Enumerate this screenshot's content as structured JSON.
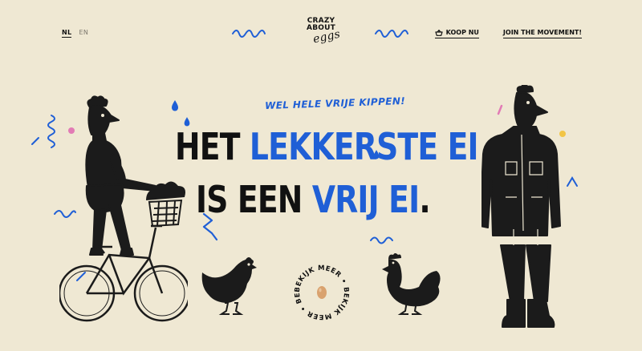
{
  "lang": {
    "active": "NL",
    "inactive": "EN"
  },
  "logo": {
    "line1": "CRAZY",
    "line2": "ABOUT",
    "line3": "eggs"
  },
  "nav": {
    "shop_label": "KOOP NU",
    "shop_icon": "basket-icon",
    "movement_label": "JOIN THE MOVEMENT!"
  },
  "hero": {
    "tagline": "WEL HELE VRIJE KIPPEN!",
    "line1_black": "HET",
    "line1_blue": "LEKKERSTE EI",
    "line2_black": "IS EEN",
    "line2_blue": "VRIJ EI",
    "line2_dot": "."
  },
  "cta": {
    "circle_text": "BEKIJK MEER • BEKIJK MEER • BEKIJK MEER • "
  },
  "colors": {
    "background": "#efe8d3",
    "accent_blue": "#1f5fd6",
    "ink": "#111111",
    "pink": "#e27bb5",
    "yellow": "#f2c545"
  }
}
